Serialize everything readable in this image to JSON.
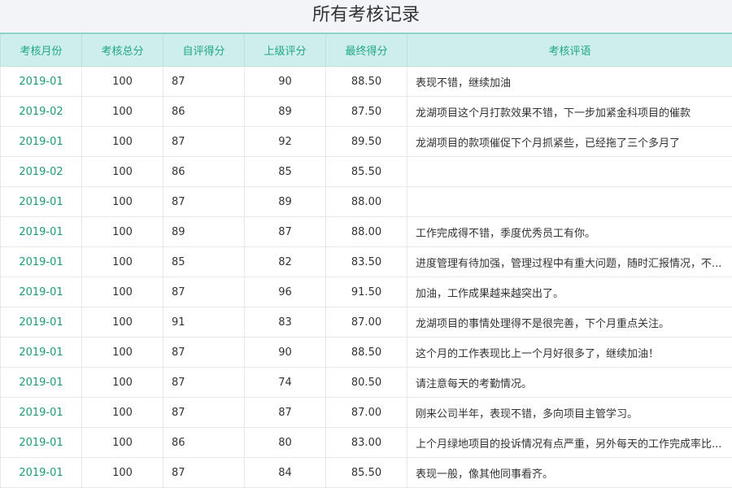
{
  "page": {
    "title": "所有考核记录"
  },
  "table": {
    "columns": [
      "考核月份",
      "考核总分",
      "自评得分",
      "上级评分",
      "最终得分",
      "考核评语"
    ],
    "rows": [
      {
        "month": "2019-01",
        "total": "100",
        "self": "87",
        "superior": "90",
        "final": "88.50",
        "comment": "表现不错，继续加油"
      },
      {
        "month": "2019-02",
        "total": "100",
        "self": "86",
        "superior": "89",
        "final": "87.50",
        "comment": "龙湖项目这个月打款效果不错，下一步加紧金科项目的催款"
      },
      {
        "month": "2019-01",
        "total": "100",
        "self": "87",
        "superior": "92",
        "final": "89.50",
        "comment": "龙湖项目的款项催促下个月抓紧些，已经拖了三个多月了"
      },
      {
        "month": "2019-02",
        "total": "100",
        "self": "86",
        "superior": "85",
        "final": "85.50",
        "comment": ""
      },
      {
        "month": "2019-01",
        "total": "100",
        "self": "87",
        "superior": "89",
        "final": "88.00",
        "comment": ""
      },
      {
        "month": "2019-01",
        "total": "100",
        "self": "89",
        "superior": "87",
        "final": "88.00",
        "comment": "工作完成得不错，季度优秀员工有你。"
      },
      {
        "month": "2019-01",
        "total": "100",
        "self": "85",
        "superior": "82",
        "final": "83.50",
        "comment": "进度管理有待加强，管理过程中有重大问题，随时汇报情况，不..."
      },
      {
        "month": "2019-01",
        "total": "100",
        "self": "87",
        "superior": "96",
        "final": "91.50",
        "comment": "加油，工作成果越来越突出了。"
      },
      {
        "month": "2019-01",
        "total": "100",
        "self": "91",
        "superior": "83",
        "final": "87.00",
        "comment": "龙湖项目的事情处理得不是很完善，下个月重点关注。"
      },
      {
        "month": "2019-01",
        "total": "100",
        "self": "87",
        "superior": "90",
        "final": "88.50",
        "comment": "这个月的工作表现比上一个月好很多了，继续加油！"
      },
      {
        "month": "2019-01",
        "total": "100",
        "self": "87",
        "superior": "74",
        "final": "80.50",
        "comment": "请注意每天的考勤情况。"
      },
      {
        "month": "2019-01",
        "total": "100",
        "self": "87",
        "superior": "87",
        "final": "87.00",
        "comment": "刚来公司半年，表现不错，多向项目主管学习。"
      },
      {
        "month": "2019-01",
        "total": "100",
        "self": "86",
        "superior": "80",
        "final": "83.00",
        "comment": "上个月绿地项目的投诉情况有点严重，另外每天的工作完成率比..."
      },
      {
        "month": "2019-01",
        "total": "100",
        "self": "87",
        "superior": "84",
        "final": "85.50",
        "comment": "表现一般，像其他同事看齐。"
      }
    ]
  }
}
